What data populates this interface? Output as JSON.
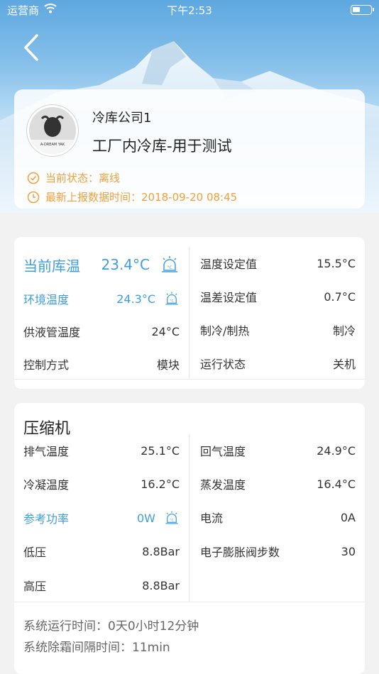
{
  "status_bar": {
    "carrier": "运营商",
    "time": "下午2:53",
    "battery_level": 0.45
  },
  "header": {
    "company": "冷库公司1",
    "warehouse": "工厂内冷库-用于测试",
    "status_label": "当前状态：离线",
    "report_label": "最新上报数据时间：2018-09-20 08:45",
    "avatar_text": "A-DREAM YAK",
    "status_color": "#f0a03c"
  },
  "temp_card": {
    "current_label": "当前库温",
    "current_value": "23.4°C",
    "env_label": "环境温度",
    "env_value": "24.3°C",
    "supply_label": "供液管温度",
    "supply_value": "24°C",
    "control_label": "控制方式",
    "control_value": "模块",
    "setpoint_label": "温度设定值",
    "setpoint_value": "15.5°C",
    "diff_label": "温差设定值",
    "diff_value": "0.7°C",
    "mode_label": "制冷/制热",
    "mode_value": "制冷",
    "run_label": "运行状态",
    "run_value": "关机"
  },
  "compressor": {
    "title": "压缩机",
    "left": [
      {
        "label": "排气温度",
        "value": "25.1°C"
      },
      {
        "label": "冷凝温度",
        "value": "16.2°C"
      },
      {
        "label": "参考功率",
        "value": "0W"
      },
      {
        "label": "低压",
        "value": "8.8Bar"
      },
      {
        "label": "高压",
        "value": "8.8Bar"
      }
    ],
    "right": [
      {
        "label": "回气温度",
        "value": "24.9°C"
      },
      {
        "label": "蒸发温度",
        "value": "16.4°C"
      },
      {
        "label": "电流",
        "value": "0A"
      },
      {
        "label": "电子膨胀阀步数",
        "value": "30"
      }
    ],
    "runtime": "系统运行时间：0天0小时12分钟",
    "defrost": "系统除霜间隔时间：11min"
  },
  "colors": {
    "accent": "#3d9ee0",
    "warning": "#f0a03c"
  },
  "icons": {
    "back": "chevron-left-icon",
    "alarm": "temperature-alarm-icon",
    "status": "check-circle-icon",
    "time": "clock-icon",
    "wifi": "wifi-icon",
    "battery": "battery-icon"
  }
}
